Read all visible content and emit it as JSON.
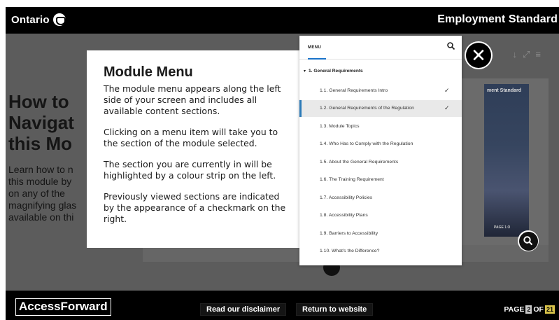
{
  "header": {
    "brand": "Ontario",
    "title": "Employment Standard"
  },
  "background": {
    "heading_lines": [
      "How to",
      "Navigat",
      "this Mo"
    ],
    "body_lines": [
      "Learn how to n",
      "this module by",
      "on any of the",
      "magnifying glas",
      "available on thi"
    ],
    "photo_title": "ment Standard",
    "photo_page": "PAGE 1 O",
    "toolbar_icons": [
      "download-icon",
      "fullscreen-icon",
      "hamburger-icon"
    ]
  },
  "info_card": {
    "title": "Module Menu",
    "paragraphs": [
      "The module menu appears along the left side of your screen and includes all available content sections.",
      "Clicking on a menu item will take you to the section of the module selected.",
      "The section you are currently in will be highlighted by a colour strip on the left.",
      "Previously viewed sections are indicated by the appearance of a checkmark on the right."
    ]
  },
  "menu": {
    "label": "MENU",
    "search_icon": "search-icon",
    "section": "1. General Requirements",
    "items": [
      {
        "label": "1.1. General Requirements Intro",
        "checked": true,
        "active": false
      },
      {
        "label": "1.2. General Requirements of the Regulation",
        "checked": true,
        "active": true
      },
      {
        "label": "1.3. Module Topics",
        "checked": false,
        "active": false
      },
      {
        "label": "1.4. Who Has to Comply with the Regulation",
        "checked": false,
        "active": false
      },
      {
        "label": "1.5. About the General Requirements",
        "checked": false,
        "active": false
      },
      {
        "label": "1.6. The Training Requirement",
        "checked": false,
        "active": false
      },
      {
        "label": "1.7. Accessibility Policies",
        "checked": false,
        "active": false
      },
      {
        "label": "1.8. Accessibility Plans",
        "checked": false,
        "active": false
      },
      {
        "label": "1.9. Barriers to Accessibility",
        "checked": false,
        "active": false
      },
      {
        "label": "1.10. What's the Difference?",
        "checked": false,
        "active": false
      }
    ],
    "accent_color": "#2b7ab8"
  },
  "footer": {
    "logo": "AccessForward",
    "disclaimer": "Read our disclaimer",
    "return": "Return to website",
    "page_prefix": "PAGE",
    "page_current": "2",
    "page_of": "OF",
    "page_total": "21"
  },
  "colors": {
    "topbar": "#000000",
    "dim_overlay": "#5c5c5c",
    "page_total_badge": "#d8c24a"
  }
}
